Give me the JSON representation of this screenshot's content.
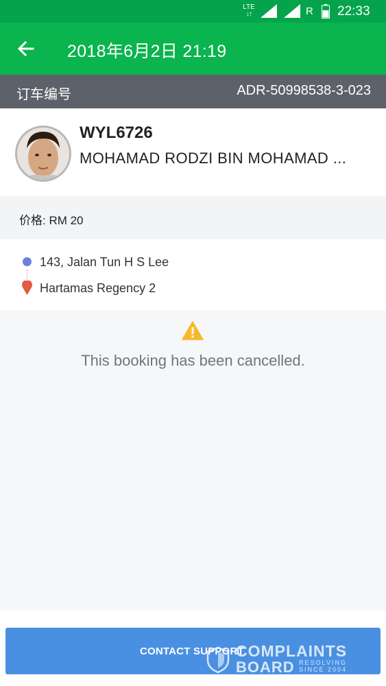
{
  "status_bar": {
    "network": "LTE",
    "roaming": "R",
    "time": "22:33",
    "icons": [
      "lte-data-icon",
      "signal-icon",
      "signal-icon",
      "battery-icon"
    ]
  },
  "header": {
    "back_icon": "arrow-left-icon",
    "title": "2018年6月2日 21:19"
  },
  "booking": {
    "label": "订车编号",
    "id": "ADR-50998538-3-023"
  },
  "driver": {
    "plate": "WYL6726",
    "name": "MOHAMAD RODZI BIN MOHAMAD ..."
  },
  "price": {
    "text": "价格: RM 20"
  },
  "route": {
    "from": "143, Jalan Tun H S Lee",
    "to": "Hartamas Regency 2"
  },
  "status": {
    "icon": "warning-icon",
    "message": "This booking has been cancelled."
  },
  "footer": {
    "button_label": "CONTACT SUPPORT"
  },
  "watermark": {
    "line1": "COMPLAINTS",
    "line2": "BOARD",
    "tag1": "RESOLVING",
    "tag2": "SINCE 2004"
  },
  "colors": {
    "status_bar": "#05a44c",
    "app_bar": "#0ab44e",
    "booking_bar": "#5d6169",
    "button": "#4a90e2",
    "warning": "#f6b92b",
    "origin_dot": "#6a7fe0",
    "destination_pin": "#e35a45"
  }
}
